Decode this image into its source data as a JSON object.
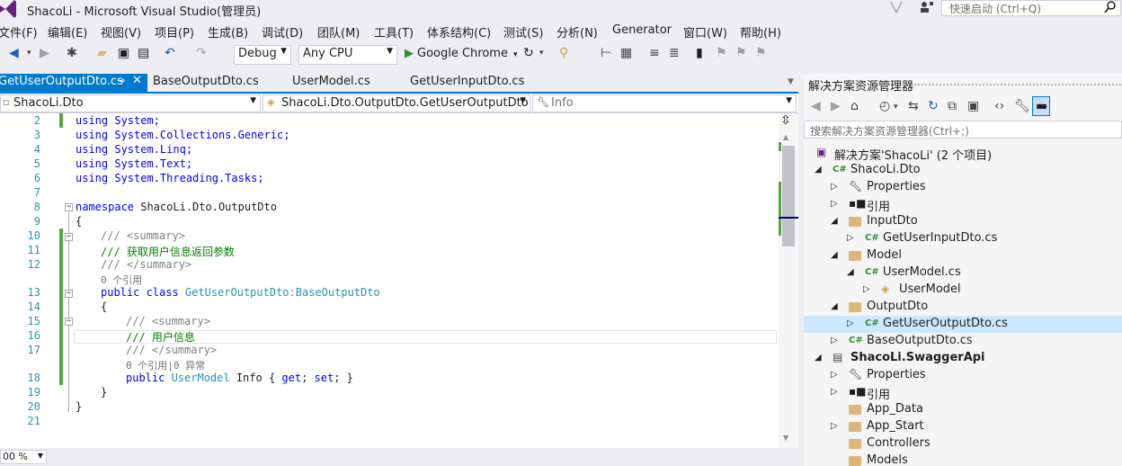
{
  "window": {
    "title": "ShacoLi - Microsoft Visual Studio(管理员)",
    "quick_launch_placeholder": "快速启动 (Ctrl+Q)"
  },
  "menu": [
    "文件(F)",
    "编辑(E)",
    "视图(V)",
    "项目(P)",
    "生成(B)",
    "调试(D)",
    "团队(M)",
    "工具(T)",
    "体系结构(C)",
    "测试(S)",
    "分析(N)",
    "Generator",
    "窗口(W)",
    "帮助(H)"
  ],
  "toolbar": {
    "configuration": "Debug",
    "platform": "Any CPU",
    "run_target": "Google Chrome"
  },
  "tabs": [
    {
      "label": "GetUserOutputDto.cs",
      "active": true
    },
    {
      "label": "BaseOutputDto.cs",
      "active": false
    },
    {
      "label": "UserModel.cs",
      "active": false
    },
    {
      "label": "GetUserInputDto.cs",
      "active": false
    }
  ],
  "navbar": {
    "project": "ShacoLi.Dto",
    "type": "ShacoLi.Dto.OutputDto.GetUserOutputDto",
    "member": "Info"
  },
  "editor": {
    "zoom": "00 %",
    "line_numbers": [
      "2",
      "3",
      "4",
      "5",
      "6",
      "7",
      "8",
      "9",
      "10",
      "11",
      "12",
      "13",
      "14",
      "15",
      "16",
      "17",
      "18",
      "19",
      "20",
      "21"
    ],
    "code": {
      "l2": "using System;",
      "l3": "using System.Collections.Generic;",
      "l4": "using System.Linq;",
      "l5": "using System.Text;",
      "l6": "using System.Threading.Tasks;",
      "l8_kw": "namespace",
      "l8_name": " ShacoLi.Dto.OutputDto",
      "l9": "{",
      "l10": "/// <summary>",
      "l11": "/// 获取用户信息返回参数",
      "l12": "/// </summary>",
      "lens1": "0 个引用",
      "l13_kw": "public class",
      "l13_name": " GetUserOutputDto",
      "l13_sep": ":",
      "l13_base": "BaseOutputDto",
      "l14": "{",
      "l15": "/// <summary>",
      "l16": "/// 用户信息",
      "l17": "/// </summary>",
      "lens2": "0 个引用|0 异常",
      "l18_kw": "public",
      "l18_type": " UserModel",
      "l18_rest": " Info { ",
      "l18_get": "get",
      "l18_semi1": "; ",
      "l18_set": "set",
      "l18_end": "; }",
      "l19": "}",
      "l20": "}"
    }
  },
  "solution_explorer": {
    "title": "解决方案资源管理器",
    "search_placeholder": "搜索解决方案资源管理器(Ctrl+;)",
    "nodes": [
      "解决方案'ShacoLi' (2 个项目)",
      "ShacoLi.Dto",
      "Properties",
      "引用",
      "InputDto",
      "GetUserInputDto.cs",
      "Model",
      "UserModel.cs",
      "UserModel",
      "OutputDto",
      "GetUserOutputDto.cs",
      "BaseOutputDto.cs",
      "ShacoLi.SwaggerApi",
      "Properties",
      "引用",
      "App_Data",
      "App_Start",
      "Controllers",
      "Models"
    ]
  },
  "colors": {
    "accent": "#007acc",
    "keyword": "#0000ff",
    "type": "#2b91af",
    "comment": "#008000",
    "change_bar": "#57a64a"
  }
}
